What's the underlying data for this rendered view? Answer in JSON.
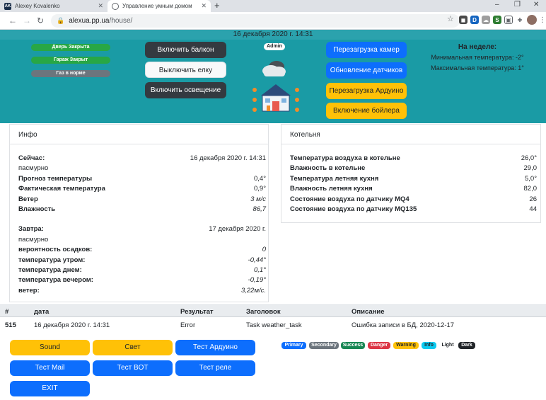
{
  "browser": {
    "tabs": [
      {
        "title": "Alexey Kovalenko",
        "favicon": "AK"
      },
      {
        "title": "Управление умным домом"
      }
    ],
    "url_host": "alexua.pp.ua",
    "url_path": "/house/"
  },
  "header": {
    "datetime": "16 декабря 2020 г. 14:31",
    "status": [
      {
        "label": "Дверь Закрыта",
        "color": "#28a745"
      },
      {
        "label": "Гараж Закрыт",
        "color": "#28a745"
      },
      {
        "label": "Газ в норме",
        "color": "#6c757d"
      }
    ],
    "switches": [
      {
        "label": "Включить балкон",
        "style": "dark"
      },
      {
        "label": "Выключить елку",
        "style": "light"
      },
      {
        "label": "Включить освещение",
        "style": "dark"
      }
    ],
    "role": "Admin",
    "actions": [
      {
        "label": "Перезагрузка камер",
        "style": "primary"
      },
      {
        "label": "Обновление датчиков",
        "style": "primary"
      },
      {
        "label": "Перезагрузка Ардуино",
        "style": "warning"
      },
      {
        "label": "Включение бойлера",
        "style": "warning"
      }
    ],
    "week": {
      "title": "На неделе:",
      "min": "Минимальная температура: -2°",
      "max": "Максимальная температура: 1°"
    }
  },
  "info": {
    "title": "Инфо",
    "today": {
      "label": "Сейчас:",
      "date": "16 декабря 2020 г. 14:31",
      "condition": "пасмурно",
      "rows": [
        {
          "k": "Прогноз температуры",
          "v": "0,4°"
        },
        {
          "k": "Фактическая температура",
          "v": "0,9°"
        },
        {
          "k": "Ветер",
          "v": "3 м/с"
        },
        {
          "k": "Влажность",
          "v": "86,7"
        }
      ]
    },
    "tomorrow": {
      "label": "Завтра:",
      "date": "17 декабря 2020 г.",
      "condition": "пасмурно",
      "rows": [
        {
          "k": "вероятность осадков:",
          "v": "0"
        },
        {
          "k": "температура утром:",
          "v": "-0,44°"
        },
        {
          "k": "температура днем:",
          "v": "0,1°"
        },
        {
          "k": "температура вечером:",
          "v": "-0,19°"
        },
        {
          "k": "ветер:",
          "v": "3,22м/с."
        }
      ]
    }
  },
  "boiler": {
    "title": "Котельня",
    "rows": [
      {
        "k": "Температура воздуха в котельне",
        "v": "26,0°"
      },
      {
        "k": "Влажность в котельне",
        "v": "29,0"
      },
      {
        "k": "Температура летняя кухня",
        "v": "5,0°"
      },
      {
        "k": "Влажность летняя кухня",
        "v": "82,0"
      },
      {
        "k": "Состояние воздуха по датчику MQ4",
        "v": "26"
      },
      {
        "k": "Состояние воздуха по датчику MQ135",
        "v": "44"
      }
    ]
  },
  "log": {
    "columns": [
      "#",
      "дата",
      "Результат",
      "Заголовок",
      "Описание"
    ],
    "rows": [
      {
        "id": "515",
        "date": "16 декабря 2020 г. 14:31",
        "result": "Error",
        "title": "Task weather_task",
        "desc": "Ошибка записи в БД, 2020-12-17"
      }
    ]
  },
  "buttons": {
    "sound": "Sound",
    "light": "Свет",
    "test_arduino": "Тест Ардуино",
    "test_mail": "Тест Mail",
    "test_bot": "Тест BOT",
    "test_relay": "Тест реле",
    "exit": "EXIT"
  },
  "badges": [
    {
      "label": "Primary",
      "color": "#0d6efd"
    },
    {
      "label": "Secondary",
      "color": "#6c757d"
    },
    {
      "label": "Success",
      "color": "#198754"
    },
    {
      "label": "Danger",
      "color": "#dc3545"
    },
    {
      "label": "Warning",
      "color": "#ffc107"
    },
    {
      "label": "Info",
      "color": "#0dcaf0"
    },
    {
      "label": "Light",
      "color": "#f8f9fa"
    },
    {
      "label": "Dark",
      "color": "#212529"
    }
  ]
}
